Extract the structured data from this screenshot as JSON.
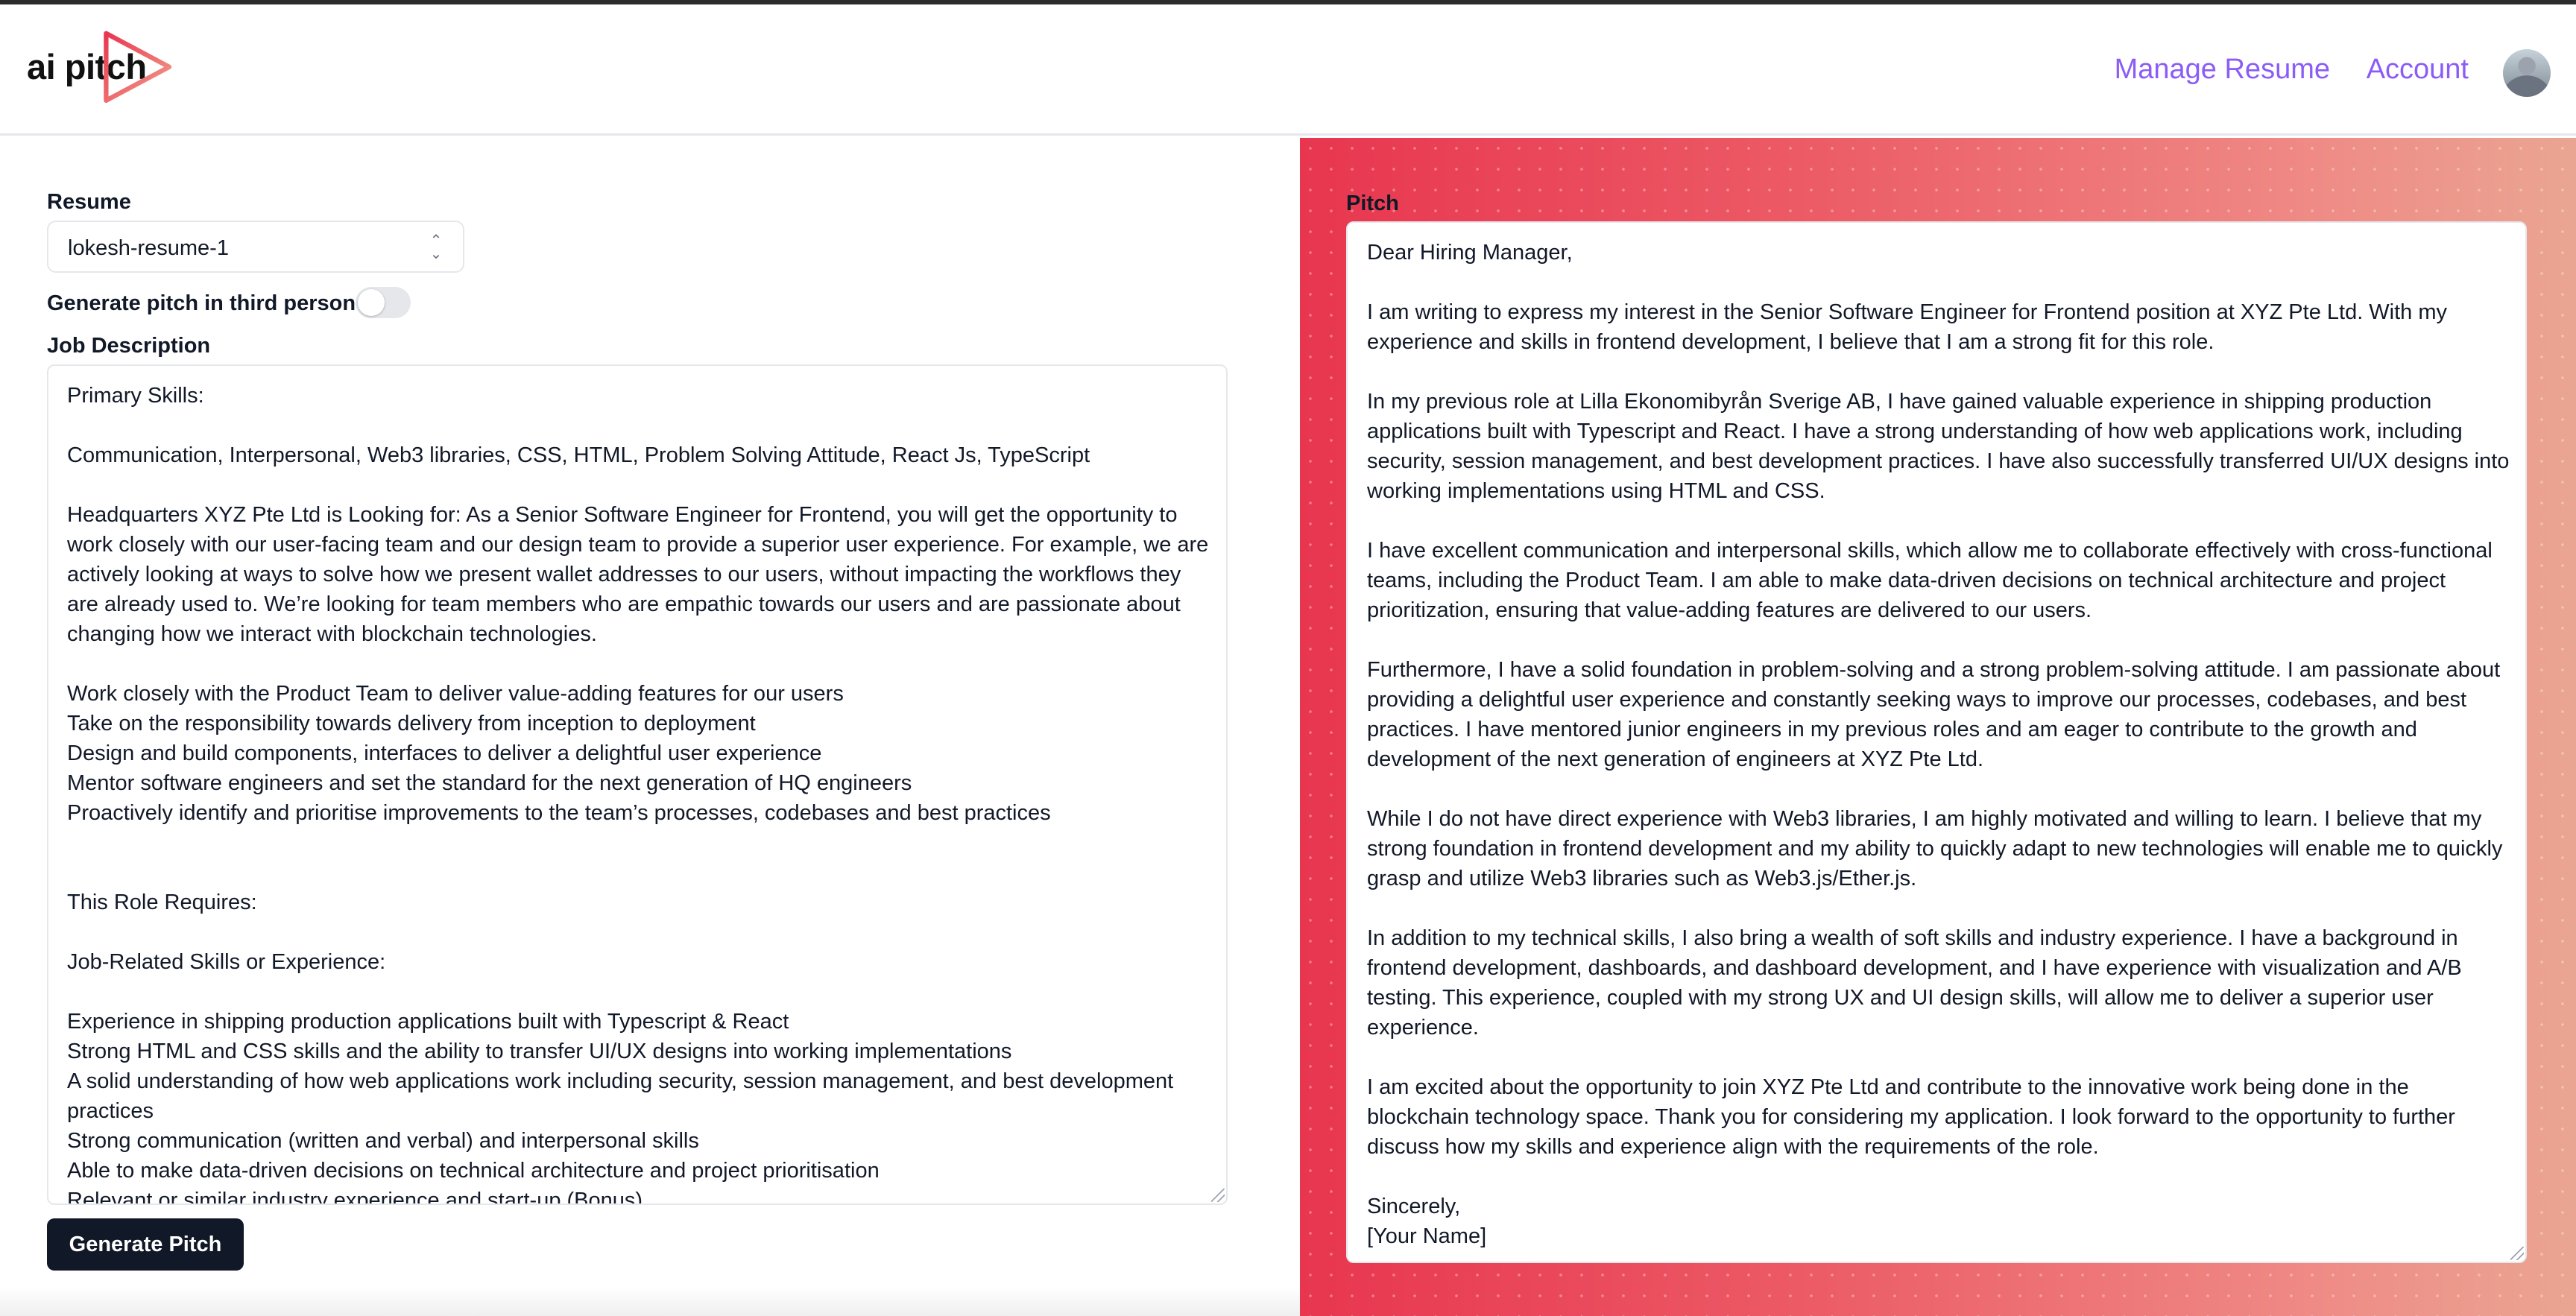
{
  "header": {
    "logo_text": "ai pitch",
    "nav": {
      "manage_resume": "Manage Resume",
      "account": "Account"
    }
  },
  "form": {
    "resume_label": "Resume",
    "resume_selected": "lokesh-resume-1",
    "third_person_label": "Generate pitch in third person",
    "third_person_enabled": false,
    "job_description_label": "Job Description",
    "job_description": "Primary Skills:\n\nCommunication, Interpersonal, Web3 libraries, CSS, HTML, Problem Solving Attitude, React Js, TypeScript\n\nHeadquarters XYZ Pte Ltd is Looking for: As a Senior Software Engineer for Frontend, you will get the opportunity to work closely with our user-facing team and our design team to provide a superior user experience. For example, we are actively looking at ways to solve how we present wallet addresses to our users, without impacting the workflows they are already used to. We’re looking for team members who are empathic towards our users and are passionate about changing how we interact with blockchain technologies.\n\nWork closely with the Product Team to deliver value-adding features for our users\nTake on the responsibility towards delivery from inception to deployment\nDesign and build components, interfaces to deliver a delightful user experience\nMentor software engineers and set the standard for the next generation of HQ engineers\nProactively identify and prioritise improvements to the team’s processes, codebases and best practices\n\n\nThis Role Requires:\n\nJob-Related Skills or Experience:\n\nExperience in shipping production applications built with Typescript & React\nStrong HTML and CSS skills and the ability to transfer UI/UX designs into working implementations\nA solid understanding of how web applications work including security, session management, and best development practices\nStrong communication (written and verbal) and interpersonal skills\nAble to make data-driven decisions on technical architecture and project prioritisation\nRelevant or similar industry experience and start-up (Bonus)",
    "generate_button": "Generate Pitch"
  },
  "pitch": {
    "label": "Pitch",
    "text": "Dear Hiring Manager,\n\nI am writing to express my interest in the Senior Software Engineer for Frontend position at XYZ Pte Ltd. With my experience and skills in frontend development, I believe that I am a strong fit for this role.\n\nIn my previous role at Lilla Ekonomibyrån Sverige AB, I have gained valuable experience in shipping production applications built with Typescript and React. I have a strong understanding of how web applications work, including security, session management, and best development practices. I have also successfully transferred UI/UX designs into working implementations using HTML and CSS.\n\nI have excellent communication and interpersonal skills, which allow me to collaborate effectively with cross-functional teams, including the Product Team. I am able to make data-driven decisions on technical architecture and project prioritization, ensuring that value-adding features are delivered to our users.\n\nFurthermore, I have a solid foundation in problem-solving and a strong problem-solving attitude. I am passionate about providing a delightful user experience and constantly seeking ways to improve our processes, codebases, and best practices. I have mentored junior engineers in my previous roles and am eager to contribute to the growth and development of the next generation of engineers at XYZ Pte Ltd.\n\nWhile I do not have direct experience with Web3 libraries, I am highly motivated and willing to learn. I believe that my strong foundation in frontend development and my ability to quickly adapt to new technologies will enable me to quickly grasp and utilize Web3 libraries such as Web3.js/Ether.js.\n\nIn addition to my technical skills, I also bring a wealth of soft skills and industry experience. I have a background in frontend development, dashboards, and dashboard development, and I have experience with visualization and A/B testing. This experience, coupled with my strong UX and UI design skills, will allow me to deliver a superior user experience.\n\nI am excited about the opportunity to join XYZ Pte Ltd and contribute to the innovative work being done in the blockchain technology space. Thank you for considering my application. I look forward to the opportunity to further discuss how my skills and experience align with the requirements of the role.\n\nSincerely,\n[Your Name]"
  },
  "icons": {
    "logo": "play-triangle-icon",
    "select": "chevron-up-down-icon",
    "avatar": "user-avatar"
  },
  "colors": {
    "accent": "#8b5cf6",
    "button_bg": "#111827",
    "panel_gradient_start": "#e8364f",
    "panel_gradient_end": "#eaa592"
  }
}
